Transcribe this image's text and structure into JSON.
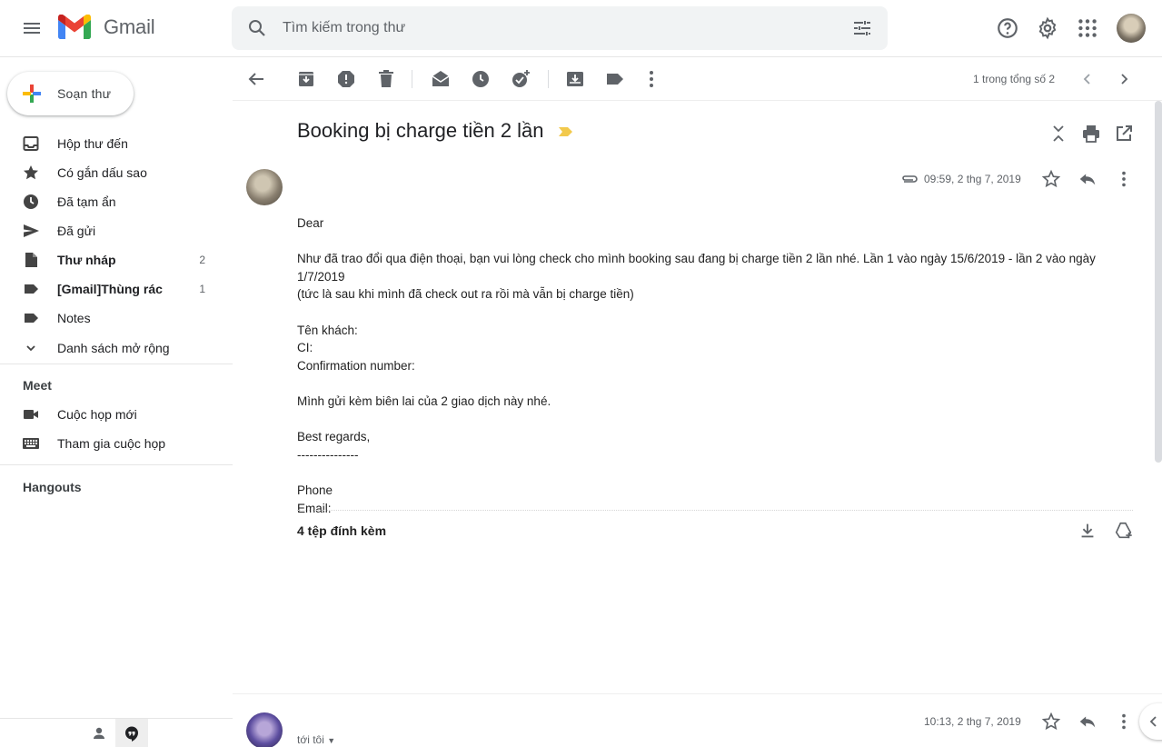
{
  "header": {
    "app_name": "Gmail",
    "search_placeholder": "Tìm kiếm trong thư",
    "icons": [
      "menu-icon",
      "search-icon",
      "tune-icon",
      "help-icon",
      "settings-icon",
      "apps-icon"
    ]
  },
  "sidebar": {
    "compose_label": "Soạn thư",
    "items": [
      {
        "label": "Hộp thư đến",
        "icon": "inbox-icon",
        "count": "",
        "bold": false
      },
      {
        "label": "Có gắn dấu sao",
        "icon": "star-icon",
        "count": "",
        "bold": false
      },
      {
        "label": "Đã tạm ẩn",
        "icon": "clock-icon",
        "count": "",
        "bold": false
      },
      {
        "label": "Đã gửi",
        "icon": "send-icon",
        "count": "",
        "bold": false
      },
      {
        "label": "Thư nháp",
        "icon": "draft-icon",
        "count": "2",
        "bold": true
      },
      {
        "label": "[Gmail]Thùng rác",
        "icon": "label-icon",
        "count": "1",
        "bold": true
      },
      {
        "label": "Notes",
        "icon": "label-icon",
        "count": "",
        "bold": false
      },
      {
        "label": "Danh sách mở rộng",
        "icon": "chevron-down-icon",
        "count": "",
        "bold": false
      }
    ],
    "meet_title": "Meet",
    "meet_items": [
      {
        "label": "Cuộc họp mới",
        "icon": "video-icon"
      },
      {
        "label": "Tham gia cuộc họp",
        "icon": "keyboard-icon"
      }
    ],
    "hangouts_title": "Hangouts"
  },
  "toolbar": {
    "pager": "1 trong tổng số 2"
  },
  "mail": {
    "subject": "Booking bị charge tiền 2 lần",
    "date": "09:59, 2 thg 7, 2019",
    "body": {
      "greeting": "Dear",
      "p1_line1": "Như đã trao đổi qua điện thoại, bạn vui lòng check cho mình booking sau đang bị charge tiền 2 lần nhé. Lần 1 vào ngày 15/6/2019 - lần 2 vào ngày 1/7/2019",
      "p1_line2": "(tức là sau khi mình đã check out ra rồi mà vẫn bị charge tiền)",
      "guest": "Tên khách:",
      "ci": "CI:",
      "confirmation": "Confirmation number:",
      "attach_note": "Mình gửi kèm biên lai của 2 giao dịch này nhé.",
      "regards": "Best regards,",
      "dashes": "---------------",
      "phone": "Phone",
      "email": "Email:"
    },
    "attachments_title": "4 tệp đính kèm"
  },
  "reply": {
    "date": "10:13, 2 thg 7, 2019",
    "to": "tới tôi"
  },
  "colors": {
    "label_yellow": "#f2c94c",
    "gmail_red": "#ea4335",
    "gmail_blue": "#4285f4",
    "gmail_green": "#34a853",
    "gmail_yellow": "#fbbc04"
  }
}
